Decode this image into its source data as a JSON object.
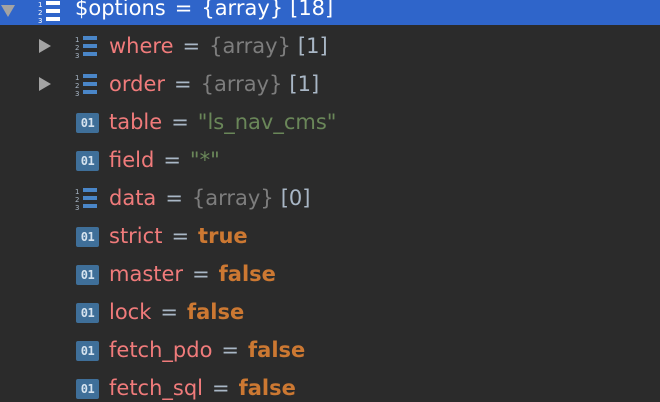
{
  "root": {
    "name": "$options",
    "eq": "=",
    "type": "{array}",
    "count": "[18]"
  },
  "items": [
    {
      "name": "where",
      "eq": "=",
      "type": "{array}",
      "count": "[1]",
      "kind": "array",
      "expandable": true
    },
    {
      "name": "order",
      "eq": "=",
      "type": "{array}",
      "count": "[1]",
      "kind": "array",
      "expandable": true
    },
    {
      "name": "table",
      "eq": "=",
      "value": "\"ls_nav_cms\"",
      "kind": "string"
    },
    {
      "name": "field",
      "eq": "=",
      "value": "\"*\"",
      "kind": "string"
    },
    {
      "name": "data",
      "eq": "=",
      "type": "{array}",
      "count": "[0]",
      "kind": "array",
      "expandable": false
    },
    {
      "name": "strict",
      "eq": "=",
      "value": "true",
      "kind": "bool"
    },
    {
      "name": "master",
      "eq": "=",
      "value": "false",
      "kind": "bool"
    },
    {
      "name": "lock",
      "eq": "=",
      "value": "false",
      "kind": "bool"
    },
    {
      "name": "fetch_pdo",
      "eq": "=",
      "value": "false",
      "kind": "bool"
    },
    {
      "name": "fetch_sql",
      "eq": "=",
      "value": "false",
      "kind": "bool"
    }
  ],
  "icons": {
    "primitive_glyph": "01",
    "array_icon": "array-list-icon",
    "primitive_icon": "primitive-value-icon"
  },
  "colors": {
    "background": "#2b2b2b",
    "selection": "#2f65ca",
    "name": "#f07b7b",
    "string": "#6a8759",
    "bool": "#cc7832",
    "type": "#7d7d7d",
    "icon_blue": "#3f6f99"
  }
}
